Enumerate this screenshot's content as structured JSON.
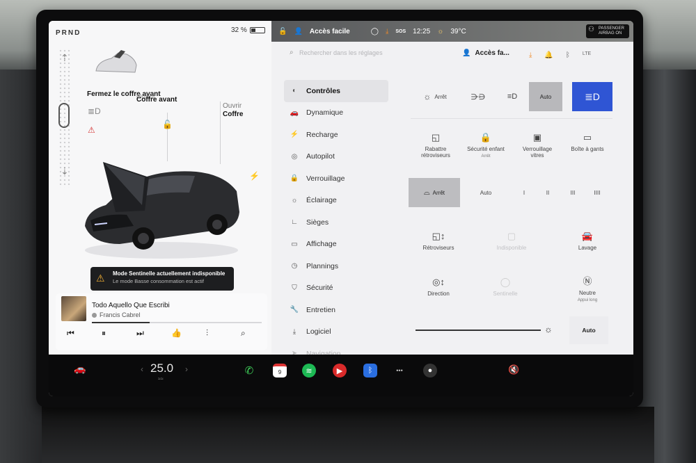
{
  "status": {
    "gear": "PRND",
    "battery_percent": "32 %",
    "battery_level": 0.32,
    "profile": "Accès facile",
    "time": "12:25",
    "outside_temp": "39°C",
    "sos": "SOS",
    "airbag_line1": "PASSENGER",
    "airbag_line2": "AIRBAG ON"
  },
  "car": {
    "close_frunk_prompt": "Fermez le coffre avant",
    "frunk_faded": "Ouvrir",
    "frunk_label": "Coffre avant",
    "trunk_top": "Ouvrir",
    "trunk_label": "Coffre"
  },
  "sentry": {
    "title": "Mode Sentinelle actuellement indisponible",
    "subtitle": "Le mode Basse consommation est actif"
  },
  "media": {
    "title": "Todo Aquello Que Escribi",
    "artist": "Francis Cabrel",
    "progress": 0.34
  },
  "settings": {
    "search_placeholder": "Rechercher dans les réglages",
    "profile_short": "Accès fa...",
    "menu": [
      {
        "label": "Contrôles",
        "icon": "toggle-icon"
      },
      {
        "label": "Dynamique",
        "icon": "car-icon"
      },
      {
        "label": "Recharge",
        "icon": "bolt-icon"
      },
      {
        "label": "Autopilot",
        "icon": "steering-wheel-icon"
      },
      {
        "label": "Verrouillage",
        "icon": "lock-icon"
      },
      {
        "label": "Éclairage",
        "icon": "sun-icon"
      },
      {
        "label": "Sièges",
        "icon": "seat-icon"
      },
      {
        "label": "Affichage",
        "icon": "display-icon"
      },
      {
        "label": "Plannings",
        "icon": "clock-icon"
      },
      {
        "label": "Sécurité",
        "icon": "shield-icon"
      },
      {
        "label": "Entretien",
        "icon": "wrench-icon"
      },
      {
        "label": "Logiciel",
        "icon": "download-icon"
      },
      {
        "label": "Navigation",
        "icon": "nav-icon"
      }
    ]
  },
  "controls": {
    "lights": {
      "off": "Arrêt",
      "auto": "Auto",
      "selected": "auto-high-beam"
    },
    "mirrors_fold": "Rabattre rétroviseurs",
    "child_lock": "Sécurité enfant",
    "child_lock_state": "Arrêt",
    "window_lock": "Verrouillage vitres",
    "glovebox": "Boîte à gants",
    "wipers": {
      "off": "Arrêt",
      "auto": "Auto",
      "speeds": [
        "I",
        "II",
        "III",
        "IIII"
      ],
      "selected": "Arrêt"
    },
    "mirrors": "Rétroviseurs",
    "unavailable": "Indisponible",
    "wash": "Lavage",
    "steering": "Direction",
    "sentinel": "Sentinelle",
    "neutral": "Neutre",
    "neutral_sub": "Appui long",
    "brightness_auto": "Auto",
    "brightness_level": 0.96
  },
  "taskbar": {
    "cabin_temp": "25.0",
    "calendar_day": "9",
    "dots": "•••"
  },
  "colors": {
    "accent_blue": "#2f55d4",
    "download_orange": "#f08a28",
    "warning_yellow": "#f2b035"
  }
}
